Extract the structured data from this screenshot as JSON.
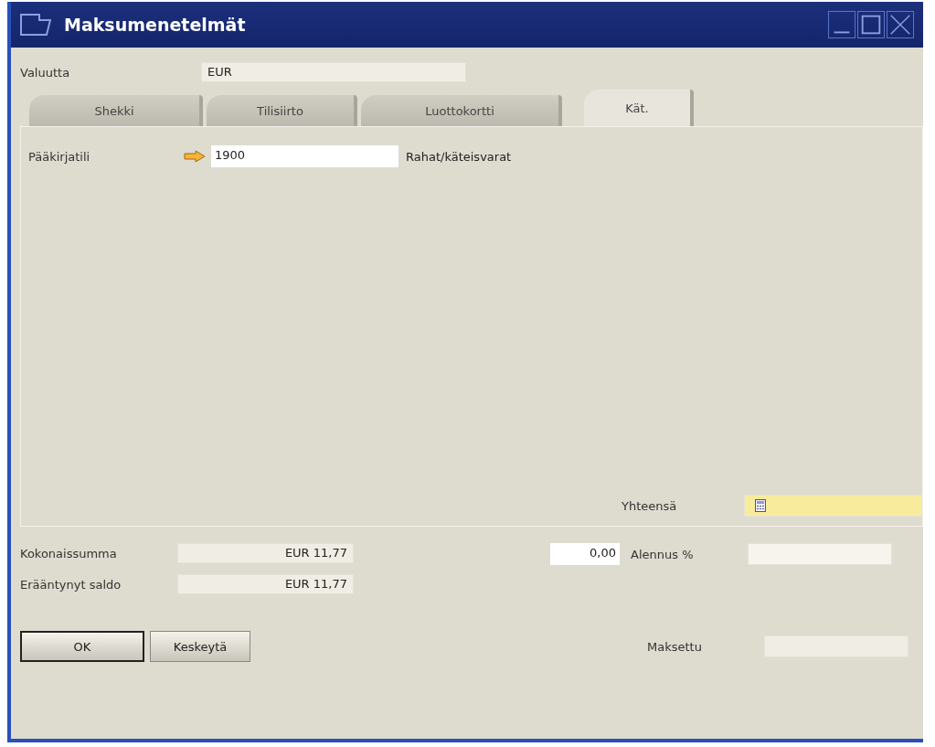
{
  "window": {
    "title": "Maksumenetelmät"
  },
  "currency": {
    "label": "Valuutta",
    "value": "EUR"
  },
  "tabs": [
    {
      "label": "Shekki",
      "selected": false
    },
    {
      "label": "Tilisiirto",
      "selected": false
    },
    {
      "label": "Luottokortti",
      "selected": false
    },
    {
      "label": "Kät.",
      "selected": true
    }
  ],
  "account": {
    "label": "Pääkirjatili",
    "value": "1900",
    "name": "Rahat/käteisvarat"
  },
  "total": {
    "label": "Yhteensä"
  },
  "summary": [
    {
      "label": "Kokonaissumma",
      "value": "EUR 11,77"
    },
    {
      "label": "Erääntynyt saldo",
      "value": "EUR 11,77"
    }
  ],
  "discount": {
    "amount": "0,00",
    "label": "Alennus %"
  },
  "paid": {
    "label": "Maksettu"
  },
  "buttons": [
    {
      "label": "OK",
      "default": true
    },
    {
      "label": "Keskeytä",
      "default": false
    }
  ]
}
